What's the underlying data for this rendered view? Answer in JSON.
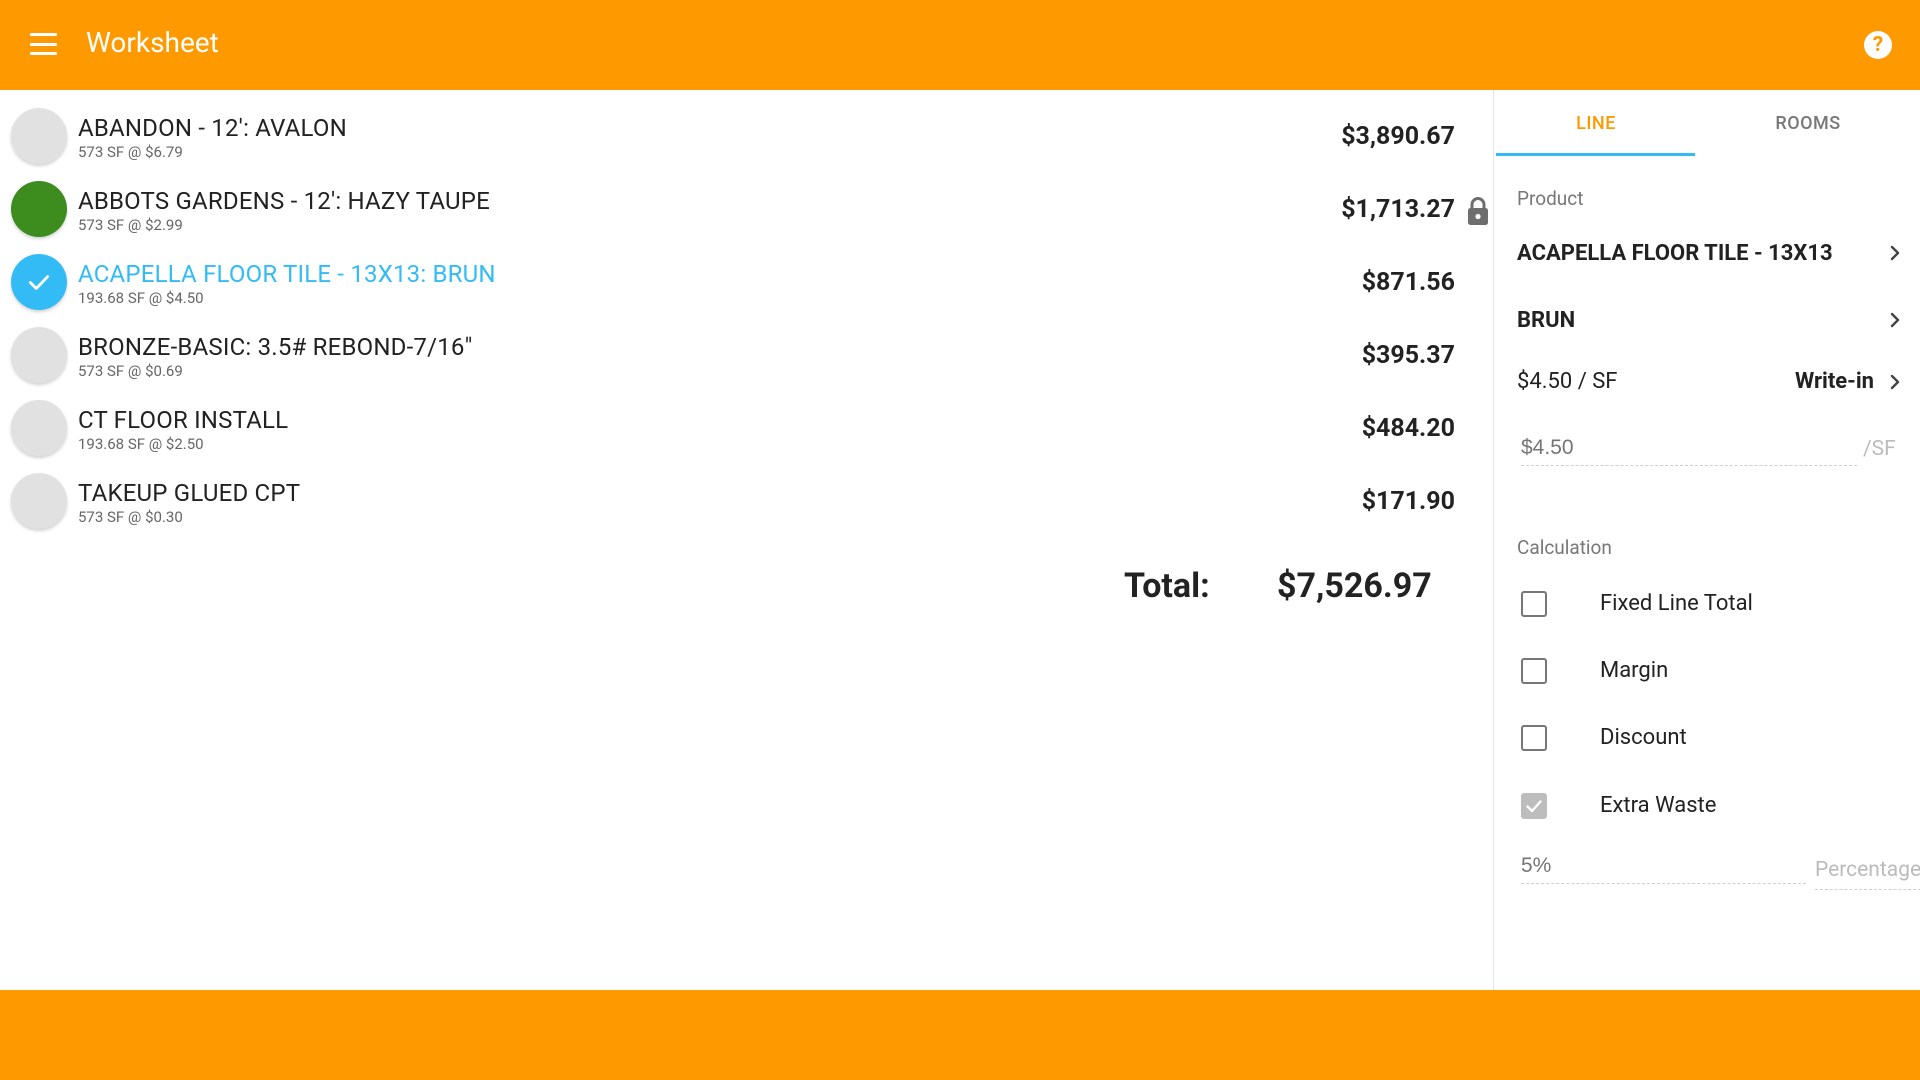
{
  "header": {
    "title": "Worksheet",
    "help_icon": "?",
    "bar_color": "#fe9a00"
  },
  "lines": [
    {
      "name": "ABANDON - 12': AVALON",
      "detail": "573 SF @ $6.79",
      "price": "$3,890.67",
      "state": "none"
    },
    {
      "name": "ABBOTS GARDENS - 12': HAZY TAUPE",
      "detail": "573 SF @ $2.99",
      "price": "$1,713.27",
      "state": "green",
      "locked": true
    },
    {
      "name": "ACAPELLA FLOOR TILE - 13X13: BRUN",
      "detail": "193.68 SF @ $4.50",
      "price": "$871.56",
      "state": "selected"
    },
    {
      "name": "BRONZE-BASIC: 3.5# REBOND-7/16\"",
      "detail": "573 SF @ $0.69",
      "price": "$395.37",
      "state": "none"
    },
    {
      "name": "CT FLOOR INSTALL",
      "detail": "193.68 SF @ $2.50",
      "price": "$484.20",
      "state": "none"
    },
    {
      "name": "TAKEUP GLUED CPT",
      "detail": "573 SF @ $0.30",
      "price": "$171.90",
      "state": "none"
    }
  ],
  "total": {
    "label": "Total:",
    "value": "$7,526.97"
  },
  "panel": {
    "tabs": [
      "LINE",
      "ROOMS"
    ],
    "active_tab": "LINE",
    "product_label": "Product",
    "product_name": "ACAPELLA FLOOR TILE - 13X13",
    "product_color": "BRUN",
    "unit_price": "$4.50 / SF",
    "write_in_label": "Write-in",
    "price_placeholder": "$4.50",
    "price_suffix": "/SF",
    "calculation_label": "Calculation",
    "options": [
      {
        "label": "Fixed Line Total",
        "checked": false
      },
      {
        "label": "Margin",
        "checked": false
      },
      {
        "label": "Discount",
        "checked": false
      },
      {
        "label": "Extra Waste",
        "checked": true
      }
    ],
    "waste_placeholder": "5%",
    "waste_suffix": "Percentage"
  },
  "colors": {
    "accent_orange": "#fe9a00",
    "selected_blue": "#33bbf5",
    "status_green": "#3c8c1e"
  }
}
